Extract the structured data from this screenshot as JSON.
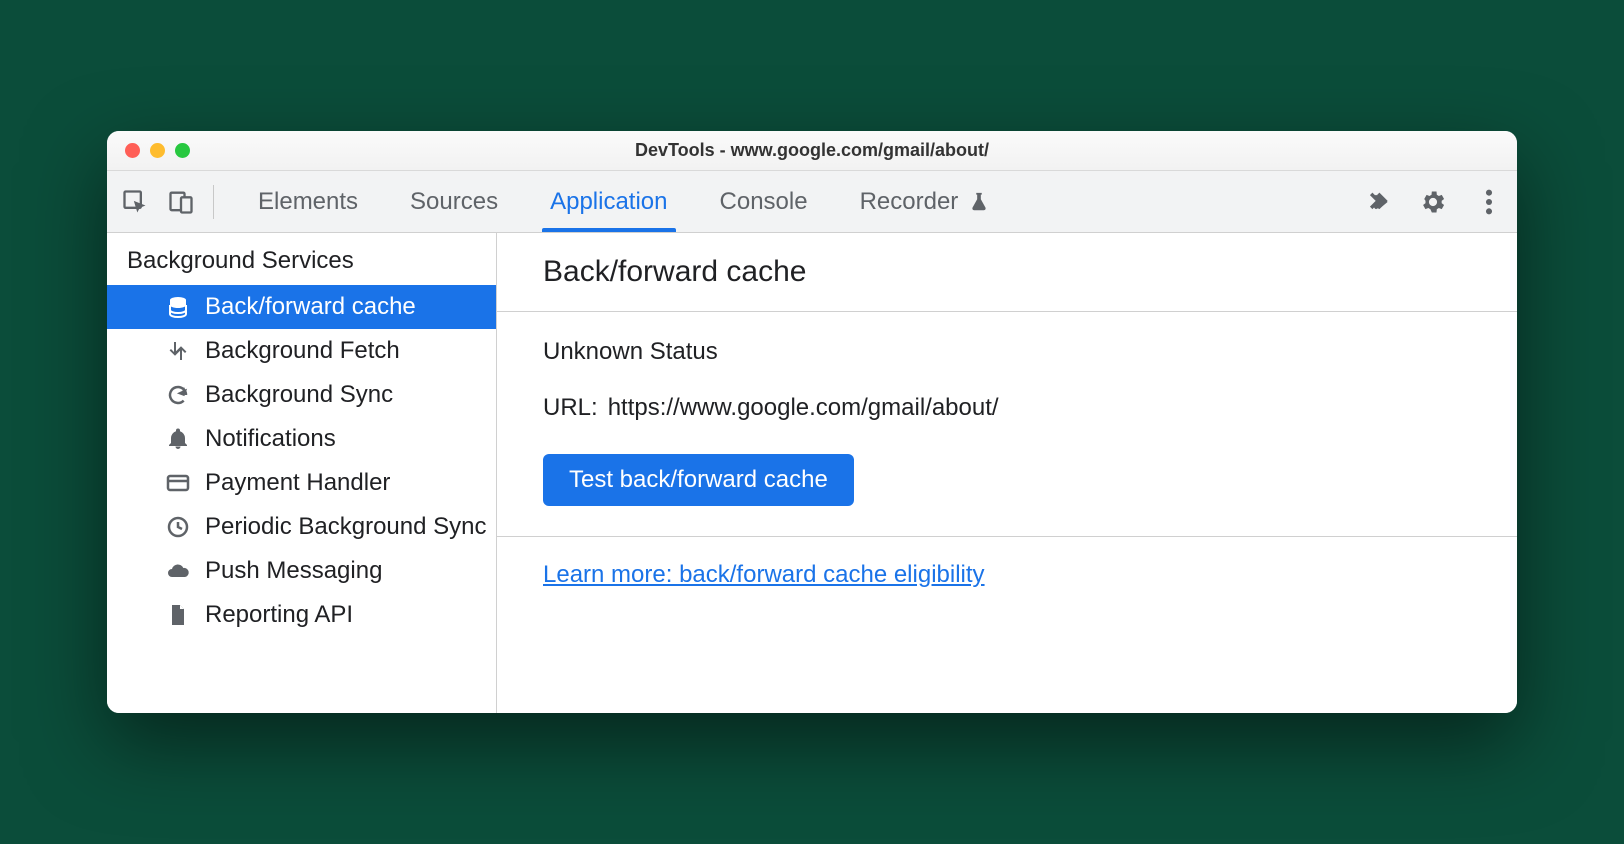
{
  "window": {
    "title": "DevTools - www.google.com/gmail/about/"
  },
  "toolbar": {
    "tabs": [
      {
        "label": "Elements"
      },
      {
        "label": "Sources"
      },
      {
        "label": "Application"
      },
      {
        "label": "Console"
      },
      {
        "label": "Recorder"
      }
    ],
    "active_tab_index": 2
  },
  "sidebar": {
    "section_title": "Background Services",
    "items": [
      {
        "icon": "database-icon",
        "label": "Back/forward cache",
        "selected": true
      },
      {
        "icon": "fetch-icon",
        "label": "Background Fetch"
      },
      {
        "icon": "sync-icon",
        "label": "Background Sync"
      },
      {
        "icon": "bell-icon",
        "label": "Notifications"
      },
      {
        "icon": "card-icon",
        "label": "Payment Handler"
      },
      {
        "icon": "clock-icon",
        "label": "Periodic Background Sync"
      },
      {
        "icon": "cloud-icon",
        "label": "Push Messaging"
      },
      {
        "icon": "file-icon",
        "label": "Reporting API"
      }
    ]
  },
  "main": {
    "heading": "Back/forward cache",
    "status": "Unknown Status",
    "url_label": "URL:",
    "url_value": "https://www.google.com/gmail/about/",
    "test_button": "Test back/forward cache",
    "learn_more": "Learn more: back/forward cache eligibility"
  }
}
